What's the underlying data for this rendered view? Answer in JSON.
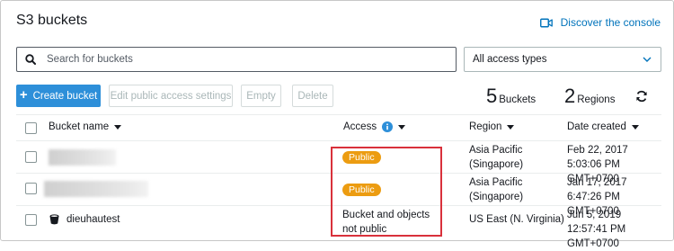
{
  "title": "S3 buckets",
  "discover_label": "Discover the console",
  "search": {
    "placeholder": "Search for buckets"
  },
  "access_filter": {
    "selected": "All access types"
  },
  "toolbar": {
    "create_label": "Create bucket",
    "edit_public_label": "Edit public access settings",
    "empty_label": "Empty",
    "delete_label": "Delete"
  },
  "summary": {
    "buckets_count": "5",
    "buckets_label": "Buckets",
    "regions_count": "2",
    "regions_label": "Regions"
  },
  "columns": {
    "name": "Bucket name",
    "access": "Access",
    "region": "Region",
    "date": "Date created"
  },
  "rows": [
    {
      "name": "",
      "access": "Public",
      "region": "Asia Pacific (Singapore)",
      "date": "Feb 22, 2017 5:03:06 PM GMT+0700"
    },
    {
      "name": "",
      "access": "Public",
      "region": "Asia Pacific (Singapore)",
      "date": "Jan 17, 2017 6:47:26 PM GMT+0700"
    },
    {
      "name": "dieuhautest",
      "access": "Bucket and objects not public",
      "region": "US East (N. Virginia)",
      "date": "Jun 5, 2019 12:57:41 PM GMT+0700"
    }
  ],
  "colors": {
    "accent": "#2d8fd9",
    "link": "#0073bb",
    "public_badge": "#ec9c11",
    "highlight": "#d9313b"
  }
}
